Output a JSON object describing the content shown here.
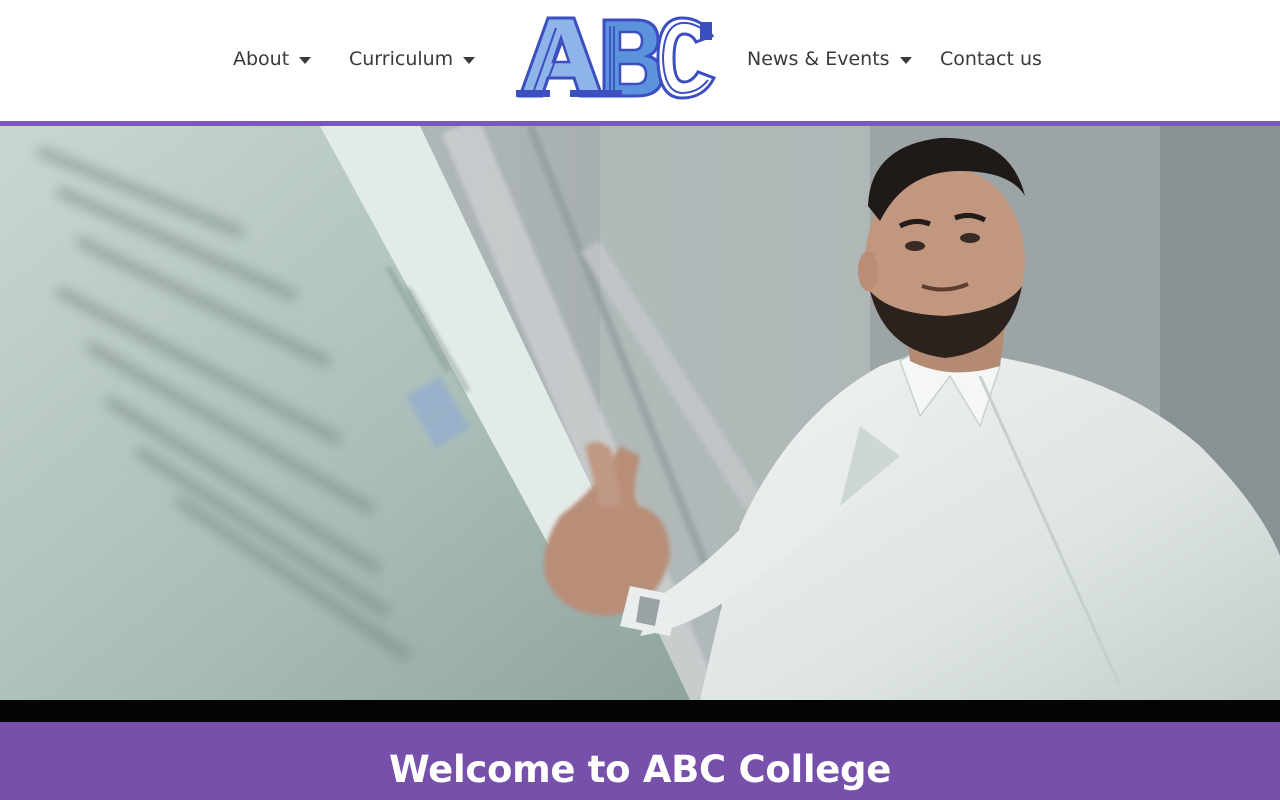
{
  "nav": {
    "about": "About",
    "curriculum": "Curriculum",
    "news_events": "News & Events",
    "contact": "Contact us"
  },
  "logo": {
    "text": "ABC",
    "colors": {
      "outline": "#3d4fbf",
      "fill_light": "#7aa6e0",
      "fill_mid": "#4a86d8"
    }
  },
  "hero": {
    "image_description_icon": "teacher-presenting-photo"
  },
  "banner": {
    "heading": "Welcome to ABC College"
  },
  "colors": {
    "accent": "#7650aa",
    "header_border": "#7a58c0",
    "nav_text": "#3a3a3a"
  }
}
